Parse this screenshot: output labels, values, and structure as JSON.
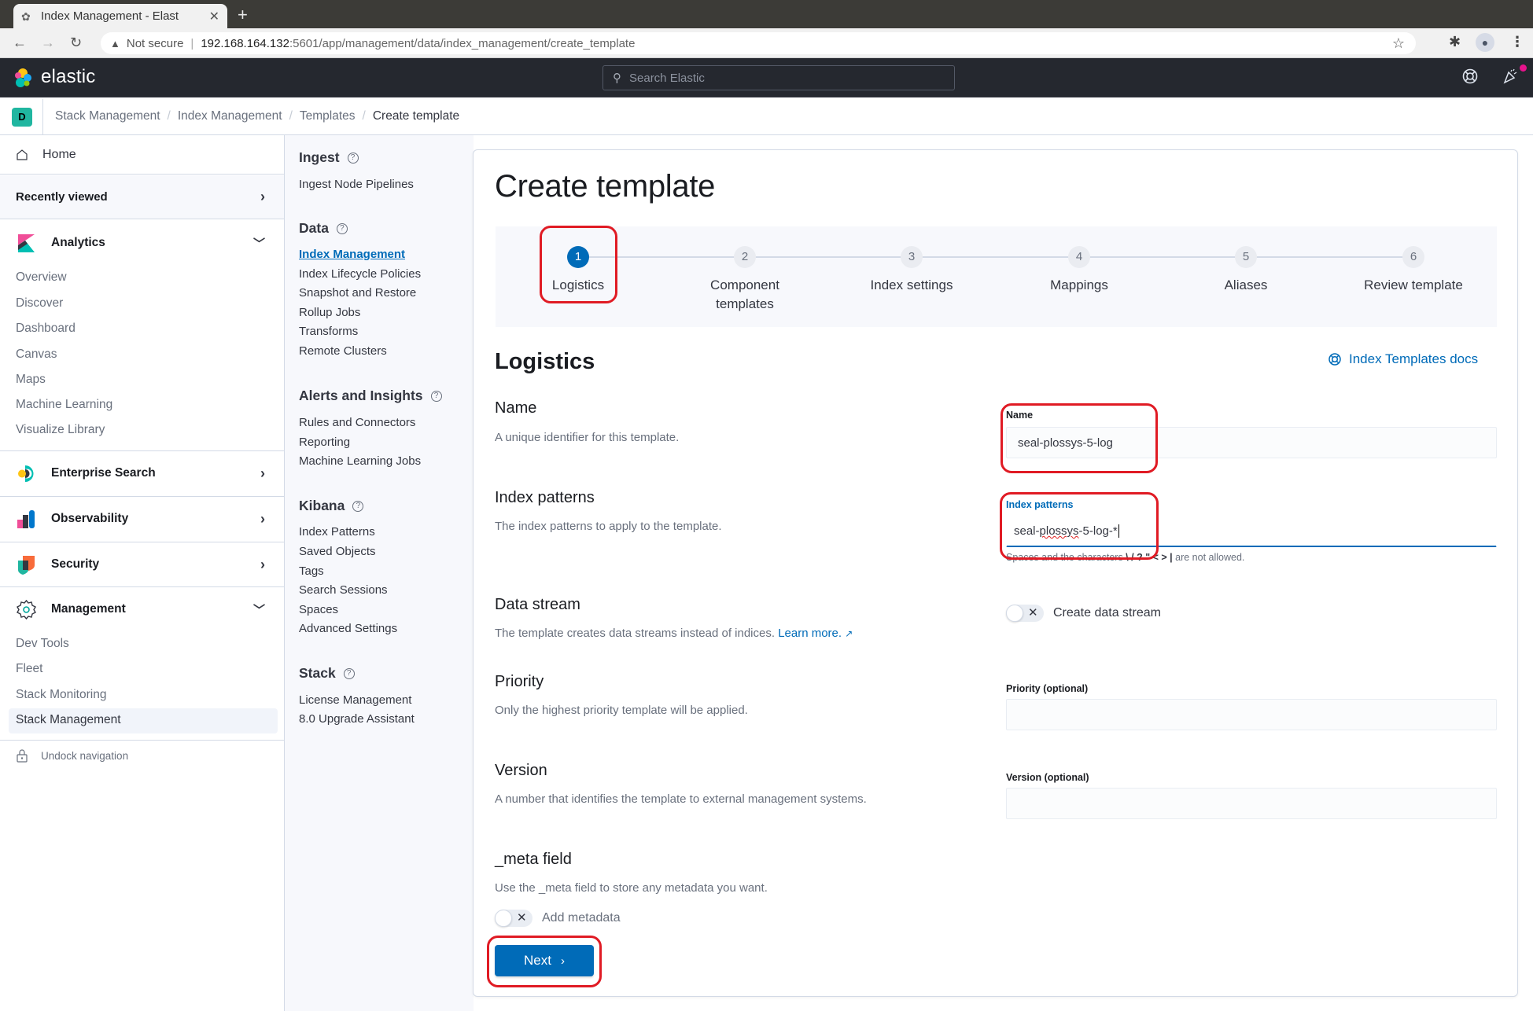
{
  "browser": {
    "tab_title": "Index Management - Elast",
    "new_tab": "+",
    "security_label": "Not secure",
    "url_host": "192.168.164.132",
    "url_path": ":5601/app/management/data/index_management/create_template"
  },
  "header": {
    "brand": "elastic",
    "search_placeholder": "Search Elastic",
    "notification_color": "#e7138c"
  },
  "breadcrumb": {
    "space_initial": "D",
    "items": [
      "Stack Management",
      "Index Management",
      "Templates",
      "Create template"
    ]
  },
  "left_nav": {
    "home": "Home",
    "recently_viewed": "Recently viewed",
    "analytics": {
      "label": "Analytics",
      "items": [
        "Overview",
        "Discover",
        "Dashboard",
        "Canvas",
        "Maps",
        "Machine Learning",
        "Visualize Library"
      ]
    },
    "enterprise_search": "Enterprise Search",
    "observability": "Observability",
    "security": "Security",
    "management": {
      "label": "Management",
      "items": [
        "Dev Tools",
        "Fleet",
        "Stack Monitoring",
        "Stack Management"
      ],
      "active": "Stack Management"
    },
    "undock": "Undock navigation"
  },
  "mgmt_nav": {
    "sections": [
      {
        "title": "Ingest",
        "items": [
          "Ingest Node Pipelines"
        ]
      },
      {
        "title": "Data",
        "items": [
          "Index Management",
          "Index Lifecycle Policies",
          "Snapshot and Restore",
          "Rollup Jobs",
          "Transforms",
          "Remote Clusters"
        ]
      },
      {
        "title": "Alerts and Insights",
        "items": [
          "Rules and Connectors",
          "Reporting",
          "Machine Learning Jobs"
        ]
      },
      {
        "title": "Kibana",
        "items": [
          "Index Patterns",
          "Saved Objects",
          "Tags",
          "Search Sessions",
          "Spaces",
          "Advanced Settings"
        ]
      },
      {
        "title": "Stack",
        "items": [
          "License Management",
          "8.0 Upgrade Assistant"
        ]
      }
    ],
    "selected": "Index Management"
  },
  "main": {
    "title": "Create template",
    "steps": [
      {
        "num": "1",
        "label": "Logistics",
        "active": true
      },
      {
        "num": "2",
        "label": "Component templates",
        "active": false
      },
      {
        "num": "3",
        "label": "Index settings",
        "active": false
      },
      {
        "num": "4",
        "label": "Mappings",
        "active": false
      },
      {
        "num": "5",
        "label": "Aliases",
        "active": false
      },
      {
        "num": "6",
        "label": "Review template",
        "active": false
      }
    ],
    "section_title": "Logistics",
    "docs_link": "Index Templates docs",
    "fields": {
      "name": {
        "heading": "Name",
        "description": "A unique identifier for this template.",
        "label": "Name",
        "value": "seal-plossys-5-log"
      },
      "index_patterns": {
        "heading": "Index patterns",
        "description": "The index patterns to apply to the template.",
        "label": "Index patterns",
        "value_prefix": "seal-",
        "value_misspelled": "plossys",
        "value_suffix": "-5-log-*",
        "help_prefix": "Spaces and the characters",
        "help_chars": "\\ / ? \" < > |",
        "help_suffix": "are not allowed."
      },
      "data_stream": {
        "heading": "Data stream",
        "description": "The template creates data streams instead of indices.",
        "learn_more": "Learn more.",
        "toggle_label": "Create data stream",
        "enabled": false
      },
      "priority": {
        "heading": "Priority",
        "description": "Only the highest priority template will be applied.",
        "label": "Priority (optional)",
        "value": ""
      },
      "version": {
        "heading": "Version",
        "description": "A number that identifies the template to external management systems.",
        "label": "Version (optional)",
        "value": ""
      },
      "meta": {
        "heading": "_meta field",
        "description": "Use the _meta field to store any metadata you want.",
        "toggle_label": "Add metadata",
        "enabled": false
      }
    },
    "next_button": "Next",
    "accent_color": "#006bb8"
  }
}
